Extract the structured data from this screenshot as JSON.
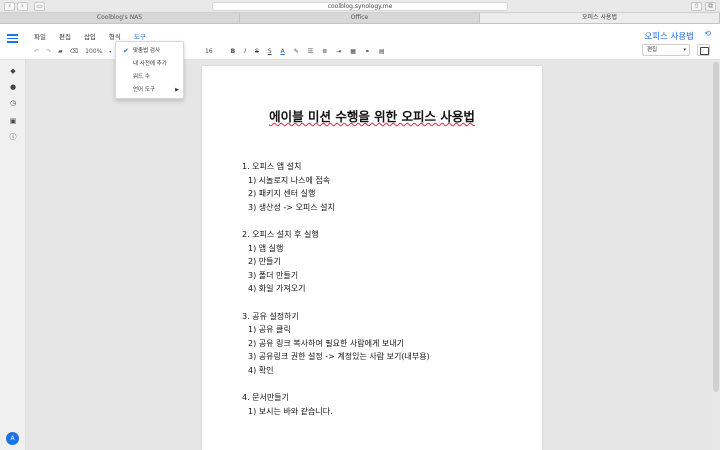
{
  "browser": {
    "url": "coolblog.synology.me",
    "tabs": [
      {
        "label": "Coolblog's NAS",
        "active": false
      },
      {
        "label": "Office",
        "active": false
      },
      {
        "label": "오피스 사용법",
        "active": true
      }
    ]
  },
  "menubar": {
    "items": [
      {
        "label": "파일"
      },
      {
        "label": "편집"
      },
      {
        "label": "삽입"
      },
      {
        "label": "형식"
      },
      {
        "label": "도구",
        "active": true
      }
    ]
  },
  "toolbar": {
    "zoom": "100%",
    "font_size": "16",
    "bold": "B",
    "italic": "I",
    "strike": "S",
    "text_color": "A"
  },
  "tools_menu": {
    "items": [
      {
        "label": "맞춤법 검사",
        "checked": true
      },
      {
        "label": "내 사전에 추가",
        "checked": false
      },
      {
        "label": "워드 수",
        "checked": false
      },
      {
        "label": "언어 도구",
        "checked": false,
        "submenu": true
      }
    ]
  },
  "header": {
    "doc_title": "오피스 사용법",
    "mode_select": "편집"
  },
  "user": {
    "avatar_initial": "A"
  },
  "document": {
    "title": "에이블 미션 수행을 위한 오피스 사용법",
    "lines": [
      {
        "text": "1. 오피스 앱 설치",
        "sub": false
      },
      {
        "text": "1) 시놀로지 나스에 접속",
        "sub": true
      },
      {
        "text": "2) 패키지 센터 실행",
        "sub": true
      },
      {
        "text": "3) 생산성 -> 오피스 설치",
        "sub": true
      },
      {
        "text": "",
        "sub": false
      },
      {
        "text": "2. 오피스 설치 후 실행",
        "sub": false
      },
      {
        "text": "1) 앱 실행",
        "sub": true
      },
      {
        "text": "2) 만들기",
        "sub": true
      },
      {
        "text": "3) 폴더 만들기",
        "sub": true
      },
      {
        "text": "4) 화일 가져오기",
        "sub": true
      },
      {
        "text": "",
        "sub": false
      },
      {
        "text": "3. 공유 설정하기",
        "sub": false
      },
      {
        "text": "1) 공유 클릭",
        "sub": true
      },
      {
        "text": "2) 공유 링크 복사하여 필요한 사람에게 보내기",
        "sub": true
      },
      {
        "text": "3) 공유링크 권한 설정 -> 계정있는 사람 보기(내부용)",
        "sub": true
      },
      {
        "text": "4) 확인",
        "sub": true
      },
      {
        "text": "",
        "sub": false
      },
      {
        "text": "4. 문서만들기",
        "sub": false
      },
      {
        "text": "1) 보시는 바와 같습니다.",
        "sub": true
      }
    ]
  },
  "colors": {
    "accent": "#1a73e8",
    "spell_error": "#ee2244"
  }
}
